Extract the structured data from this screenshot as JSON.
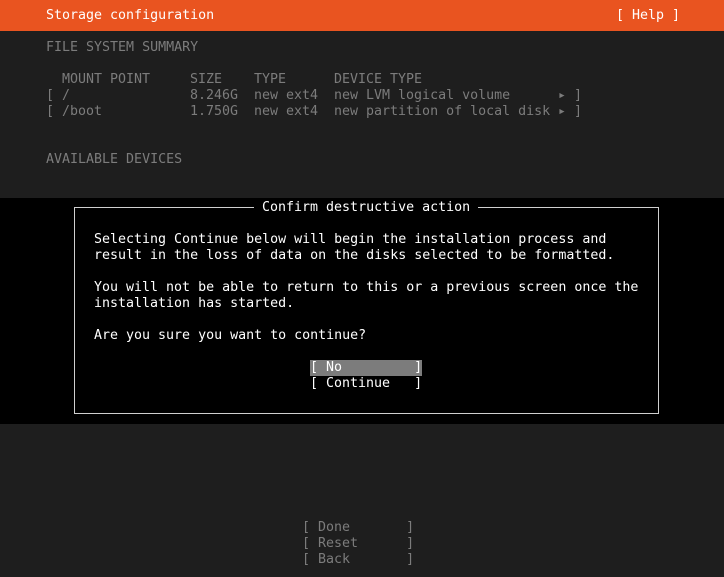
{
  "header": {
    "title": "Storage configuration",
    "help": "[ Help ]"
  },
  "summary": {
    "heading": "FILE SYSTEM SUMMARY",
    "columns": [
      "MOUNT POINT",
      "SIZE",
      "TYPE",
      "DEVICE TYPE"
    ],
    "rows": [
      {
        "open": "[",
        "mount": "/",
        "size": "8.246G",
        "type": "new ext4",
        "device": "new LVM logical volume",
        "arrow": "▸ ]"
      },
      {
        "open": "[",
        "mount": "/boot",
        "size": "1.750G",
        "type": "new ext4",
        "device": "new partition of local disk",
        "arrow": "▸ ]"
      }
    ]
  },
  "available": {
    "heading": "AVAILABLE DEVICES"
  },
  "dialog": {
    "title": "Confirm destructive action",
    "para1_line1": "Selecting Continue below will begin the installation process and",
    "para1_line2": "result in the loss of data on the disks selected to be formatted.",
    "para2_line1": "You will not be able to return to this or a previous screen once the",
    "para2_line2": "installation has started.",
    "question": "Are you sure you want to continue?",
    "no_button": "[ No         ]",
    "continue_button": "[ Continue   ]"
  },
  "footer": {
    "done": "[ Done       ]",
    "reset": "[ Reset      ]",
    "back": "[ Back       ]"
  },
  "colors": {
    "accent": "#e95420",
    "background": "#1e1e1e"
  }
}
